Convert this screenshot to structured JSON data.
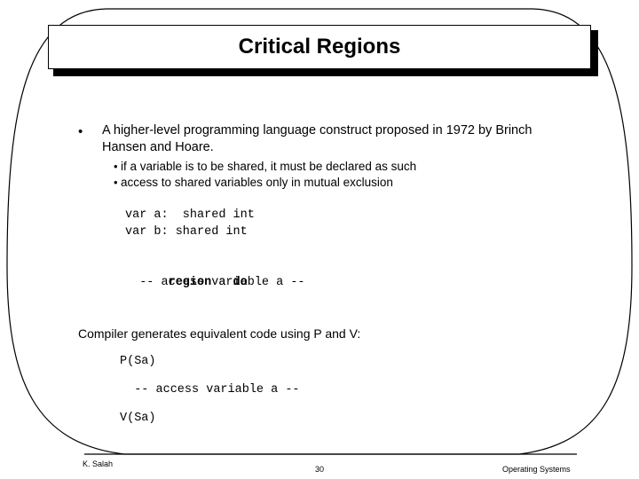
{
  "slide": {
    "title": "Critical Regions",
    "body": {
      "main_bullet": {
        "marker": "•",
        "text": "A higher-level programming language construct proposed in 1972 by Brinch Hansen and Hoare."
      },
      "sub_bullets": [
        {
          "marker": "•",
          "text": "if a variable is to be shared, it must be declared as such"
        },
        {
          "marker": "•",
          "text": "access to shared variables only in mutual exclusion"
        }
      ],
      "declaration_code": [
        "var a:  shared int",
        "var b: shared int"
      ],
      "region_block": {
        "keyword_region": "region",
        "variable": " a ",
        "keyword_do": "do",
        "access_line": "  -- access variable a --"
      },
      "compiler_note": "Compiler generates equivalent code using P and V:",
      "semaphore_code": {
        "p_operation": "P(Sa)",
        "access_line": "  -- access variable a --",
        "v_operation": "V(Sa)"
      }
    },
    "footer": {
      "author": "K. Salah",
      "page_number": "30",
      "course": "Operating Systems"
    }
  }
}
